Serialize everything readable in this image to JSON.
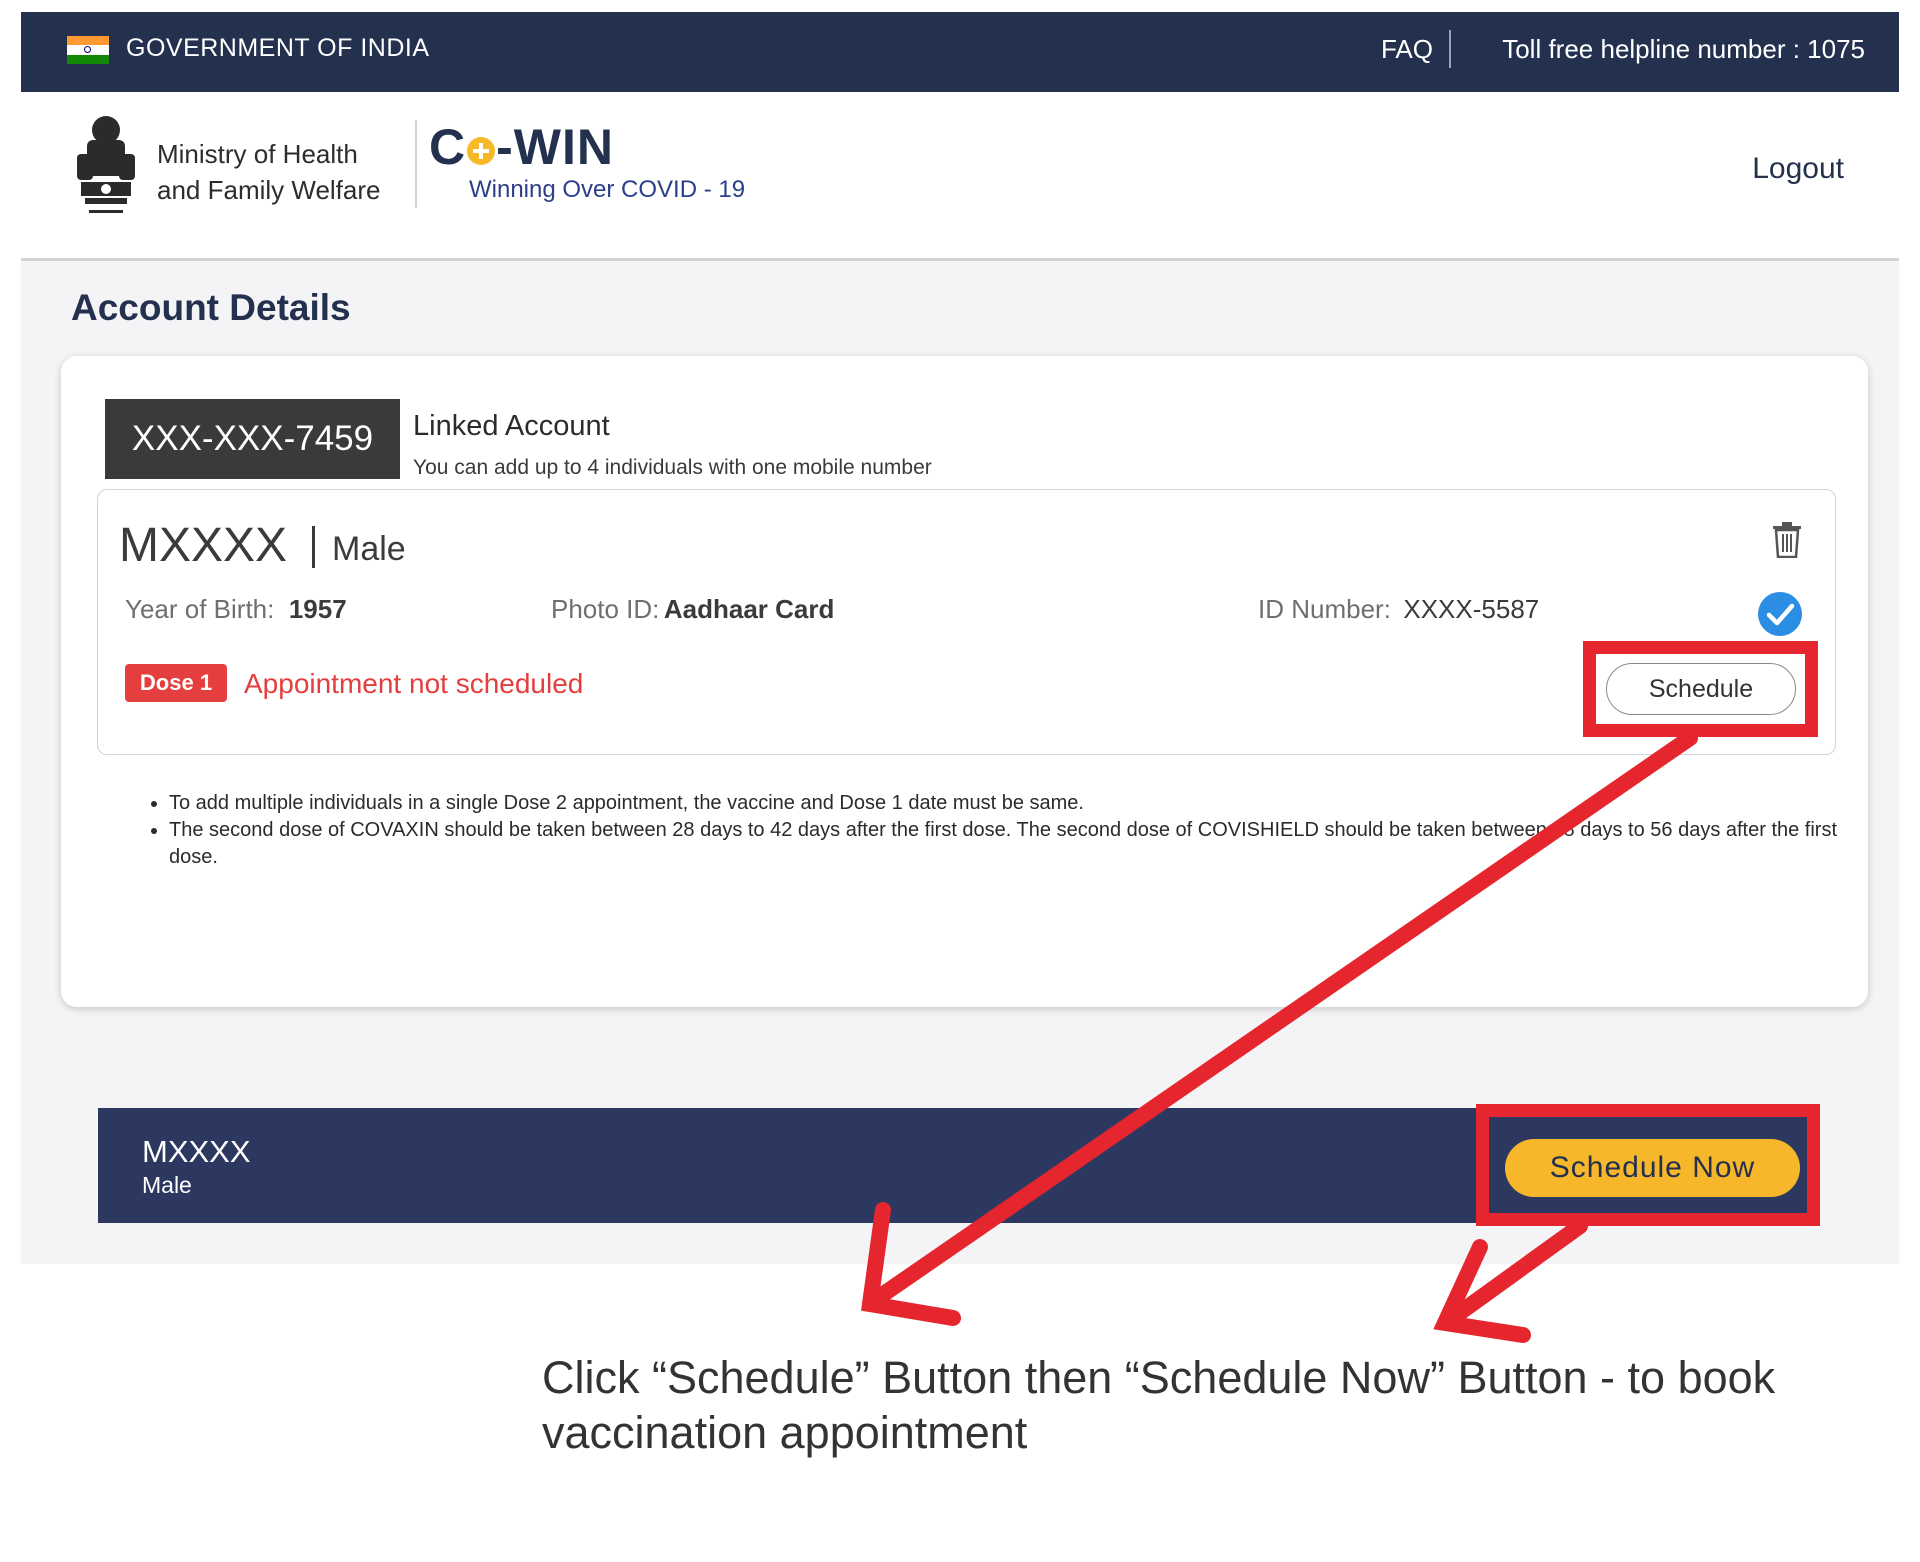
{
  "topbar": {
    "gov_title": "GOVERNMENT OF INDIA",
    "faq": "FAQ",
    "helpline": "Toll free helpline number : 1075",
    "flag_colors": [
      "#ff9933",
      "#ffffff",
      "#138808"
    ]
  },
  "header": {
    "ministry_line1": "Ministry of Health",
    "ministry_line2": "and Family Welfare",
    "app_logo_pre": "C",
    "app_logo_post": "-WIN",
    "app_tagline": "Winning Over COVID - 19",
    "logout": "Logout",
    "emblem_icon": "national-emblem-icon"
  },
  "page": {
    "title": "Account Details"
  },
  "account": {
    "mobile": "XXX-XXX-7459",
    "linked_title": "Linked Account",
    "linked_subtitle": "You can add up to 4 individuals with one mobile number"
  },
  "member": {
    "name": "MXXXX",
    "gender": "Male",
    "yob_label": "Year of Birth:",
    "yob_value": "1957",
    "photo_id_label": "Photo ID:",
    "photo_id_value": "Aadhaar Card",
    "id_number_label": "ID Number:",
    "id_number_value": "XXXX-5587",
    "dose_badge": "Dose 1",
    "appointment_status": "Appointment not scheduled",
    "schedule_label": "Schedule"
  },
  "notes": [
    "To add multiple individuals in a single Dose 2 appointment, the vaccine and Dose 1 date must be same.",
    "The second dose of COVAXIN should be taken between 28 days to 42 days after the first dose. The second dose of COVISHIELD should be taken between 28 days to 56 days after the first dose."
  ],
  "schedule_bar": {
    "name": "MXXXX",
    "gender": "Male",
    "button_label": "Schedule Now"
  },
  "caption": "Click “Schedule” Button then “Schedule Now” Button - to book vaccination appointment",
  "colors": {
    "navy": "#23304e",
    "accent_yellow": "#f6b72a",
    "alert_red": "#e53e3e",
    "highlight_red": "#e5262e",
    "check_blue": "#2b8de3"
  }
}
